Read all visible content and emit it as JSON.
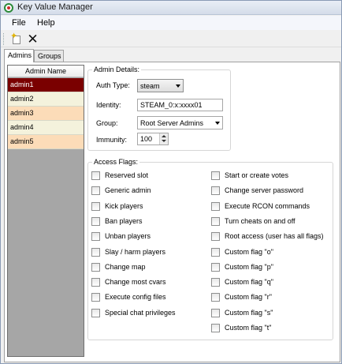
{
  "window": {
    "title": "Key Value Manager"
  },
  "menu": {
    "file": "File",
    "help": "Help"
  },
  "toolbar": {
    "new_icon": "new-document-icon",
    "delete_icon": "delete-x-icon",
    "delete_glyph": "✕"
  },
  "tabs": {
    "admins": "Admins",
    "groups": "Groups"
  },
  "list": {
    "header": "Admin Name",
    "items": [
      {
        "label": "admin1",
        "selected": true
      },
      {
        "label": "admin2",
        "selected": false
      },
      {
        "label": "admin3",
        "selected": false
      },
      {
        "label": "admin4",
        "selected": false
      },
      {
        "label": "admin5",
        "selected": false
      }
    ]
  },
  "details": {
    "title": "Admin Details:",
    "auth_type_label": "Auth Type:",
    "auth_type_value": "steam",
    "identity_label": "Identity:",
    "identity_value": "STEAM_0:x:xxxx01",
    "group_label": "Group:",
    "group_value": "Root Server Admins",
    "immunity_label": "Immunity:",
    "immunity_value": "100"
  },
  "flags": {
    "title": "Access Flags:",
    "left": [
      "Reserved slot",
      "Generic admin",
      "Kick players",
      "Ban players",
      "Unban players",
      "Slay / harm players",
      "Change map",
      "Change most cvars",
      "Execute config files",
      "Special chat privileges"
    ],
    "right": [
      "Start or create votes",
      "Change server password",
      "Execute RCON commands",
      "Turn cheats on and off",
      "Root access (user has all flags)",
      "Custom flag \"o\"",
      "Custom flag \"p\"",
      "Custom flag \"q\"",
      "Custom flag \"r\"",
      "Custom flag \"s\"",
      "Custom flag \"t\""
    ]
  },
  "colors": {
    "selected_row": "#7a0000",
    "row_yellow": "#f4f2dc",
    "row_orange": "#fcdcb8",
    "list_bg": "#a6a6a6"
  }
}
